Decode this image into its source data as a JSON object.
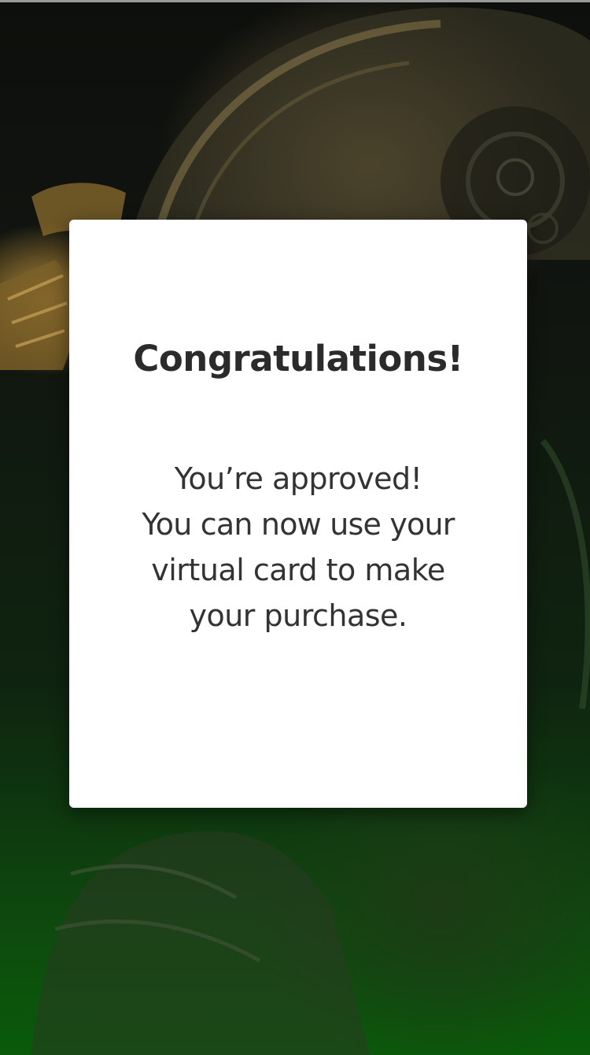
{
  "dialog": {
    "title": "Congratulations!",
    "message_lines": [
      "You’re approved!",
      "You can now use your",
      "virtual card to make",
      "your purchase."
    ]
  },
  "colors": {
    "card_background": "#ffffff",
    "title_text": "#2b2b2b",
    "body_text": "#333333",
    "background_gradient_bottom": "#0a5a0a"
  },
  "background": {
    "icon": "armored-helmet-artwork"
  }
}
